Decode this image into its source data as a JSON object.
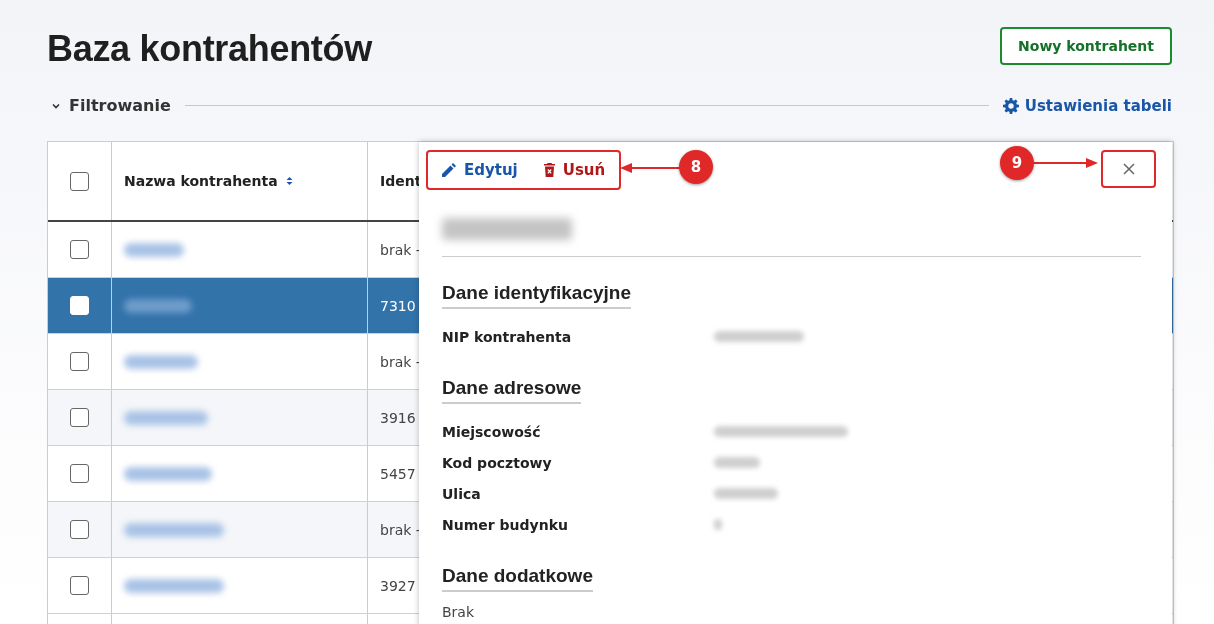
{
  "page": {
    "title": "Baza kontrahentów",
    "new_button": "Nowy kontrahent"
  },
  "filter": {
    "label": "Filtrowanie",
    "expanded": true,
    "settings_link": "Ustawienia tabeli"
  },
  "table": {
    "header_checkbox": {
      "checked": false
    },
    "columns": [
      "Nazwa kontrahenta",
      "Ident"
    ],
    "rows": [
      {
        "selected": false,
        "checked": false,
        "ident": "brak -"
      },
      {
        "selected": true,
        "checked": false,
        "ident": "7310"
      },
      {
        "selected": false,
        "checked": false,
        "ident": "brak -"
      },
      {
        "selected": false,
        "checked": false,
        "ident": "3916"
      },
      {
        "selected": false,
        "checked": false,
        "ident": "5457"
      },
      {
        "selected": false,
        "checked": false,
        "ident": "brak -"
      },
      {
        "selected": false,
        "checked": false,
        "ident": "3927"
      }
    ]
  },
  "detail_panel": {
    "actions": [
      {
        "kind": "edit",
        "label": "Edytuj"
      },
      {
        "kind": "delete",
        "label": "Usuń"
      }
    ],
    "sections": [
      {
        "title": "Dane identyfikacyjne",
        "fields": [
          {
            "label": "NIP kontrahenta"
          }
        ]
      },
      {
        "title": "Dane adresowe",
        "fields": [
          {
            "label": "Miejscowość"
          },
          {
            "label": "Kod pocztowy"
          },
          {
            "label": "Ulica"
          },
          {
            "label": "Numer budynku"
          }
        ]
      },
      {
        "title": "Dane dodatkowe",
        "text": "Brak"
      }
    ]
  },
  "annotations": [
    {
      "number": "8"
    },
    {
      "number": "9"
    }
  ]
}
